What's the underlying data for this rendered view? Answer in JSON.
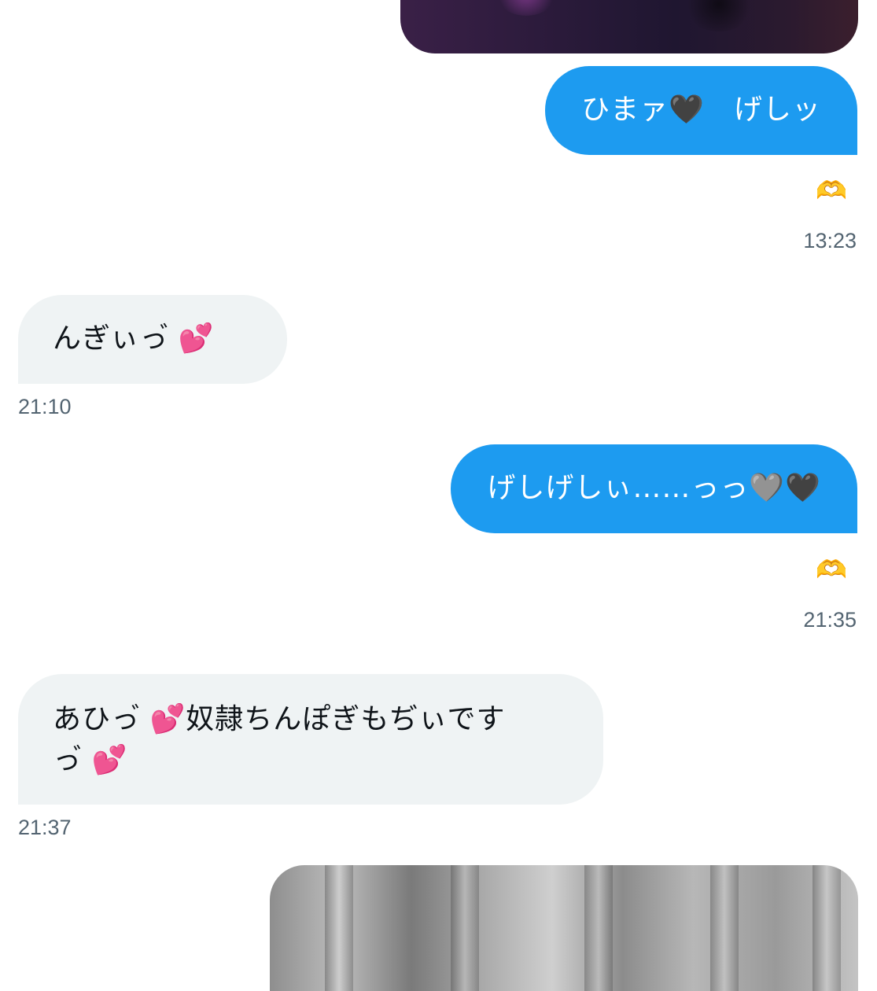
{
  "messages": [
    {
      "direction": "sent",
      "text": "ひまァ🖤　げしッ",
      "reaction": "🫶",
      "time": "13:23"
    },
    {
      "direction": "received",
      "text": "んぎぃっ゙ 💕",
      "time": "21:10"
    },
    {
      "direction": "sent",
      "text": "げしげしぃ……っっ🩶🖤",
      "reaction": "🫶",
      "time": "21:35"
    },
    {
      "direction": "received",
      "lines": [
        "あひっ゙ 💕奴隷ちんぽぎもぢぃです",
        "っ゙ 💕"
      ],
      "time": "21:37"
    }
  ]
}
